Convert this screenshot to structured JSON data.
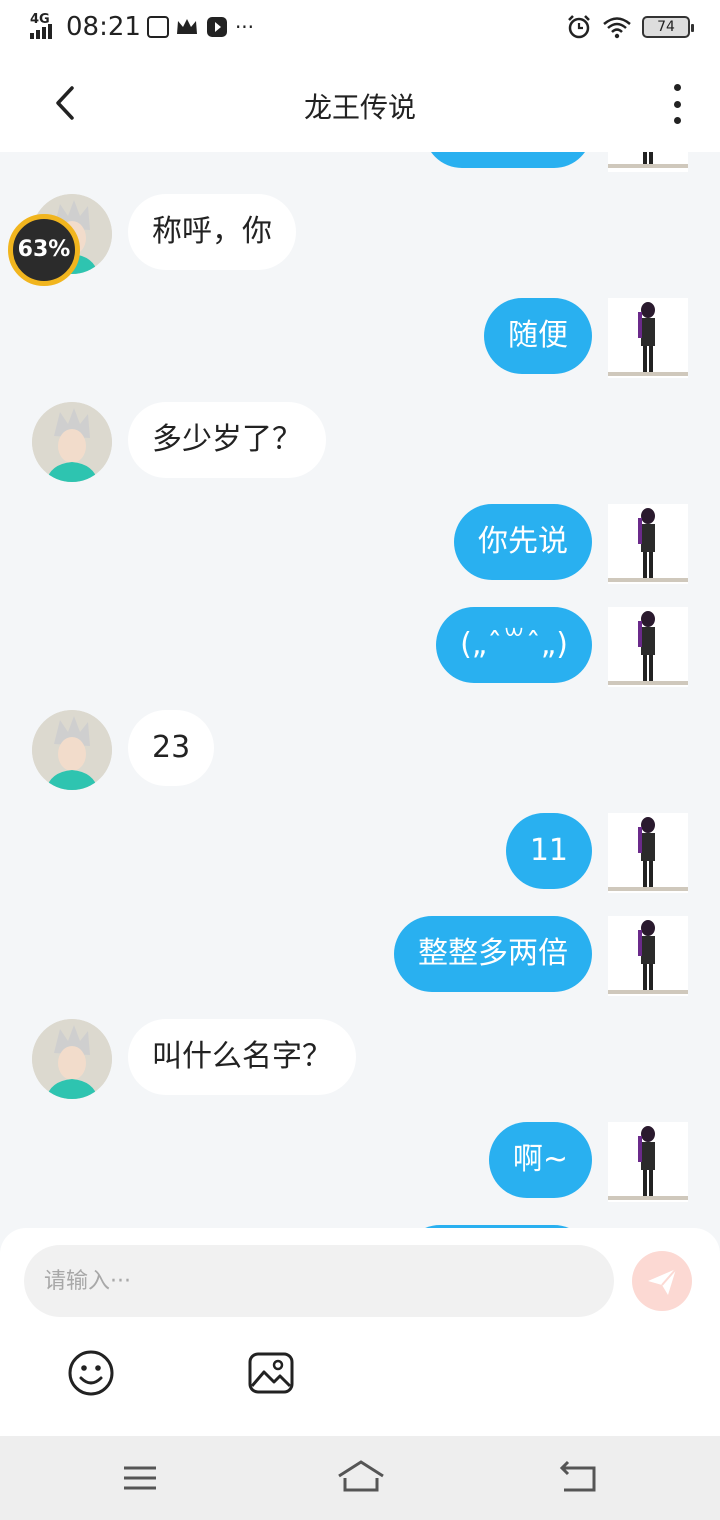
{
  "status_bar": {
    "network": "4G",
    "time": "08:21",
    "more": "···",
    "battery": "74"
  },
  "header": {
    "title": "龙王传说"
  },
  "chat": {
    "messages": [
      {
        "side": "right",
        "text": ""
      },
      {
        "side": "left",
        "text": "称呼，你"
      },
      {
        "side": "right",
        "text": "随便"
      },
      {
        "side": "left",
        "text": "多少岁了？"
      },
      {
        "side": "right",
        "text": "你先说"
      },
      {
        "side": "right",
        "text": "(„ˆ꒳ˆ„)"
      },
      {
        "side": "left",
        "text": "23"
      },
      {
        "side": "right",
        "text": "11"
      },
      {
        "side": "right",
        "text": "整整多两倍"
      },
      {
        "side": "left",
        "text": "叫什么名字？"
      },
      {
        "side": "right",
        "text": "啊~"
      }
    ]
  },
  "overlay": {
    "progress_text": "63%",
    "progress_value": 0.63
  },
  "input": {
    "placeholder": "请输入···"
  },
  "colors": {
    "accent": "#29b0f0",
    "background": "#f4f6f8",
    "send_button": "#fcd9d3"
  },
  "icons": {
    "back": "chevron-left-icon",
    "more": "more-vertical-icon",
    "send": "paper-plane-icon",
    "emoji": "smiley-icon",
    "image": "image-icon"
  }
}
